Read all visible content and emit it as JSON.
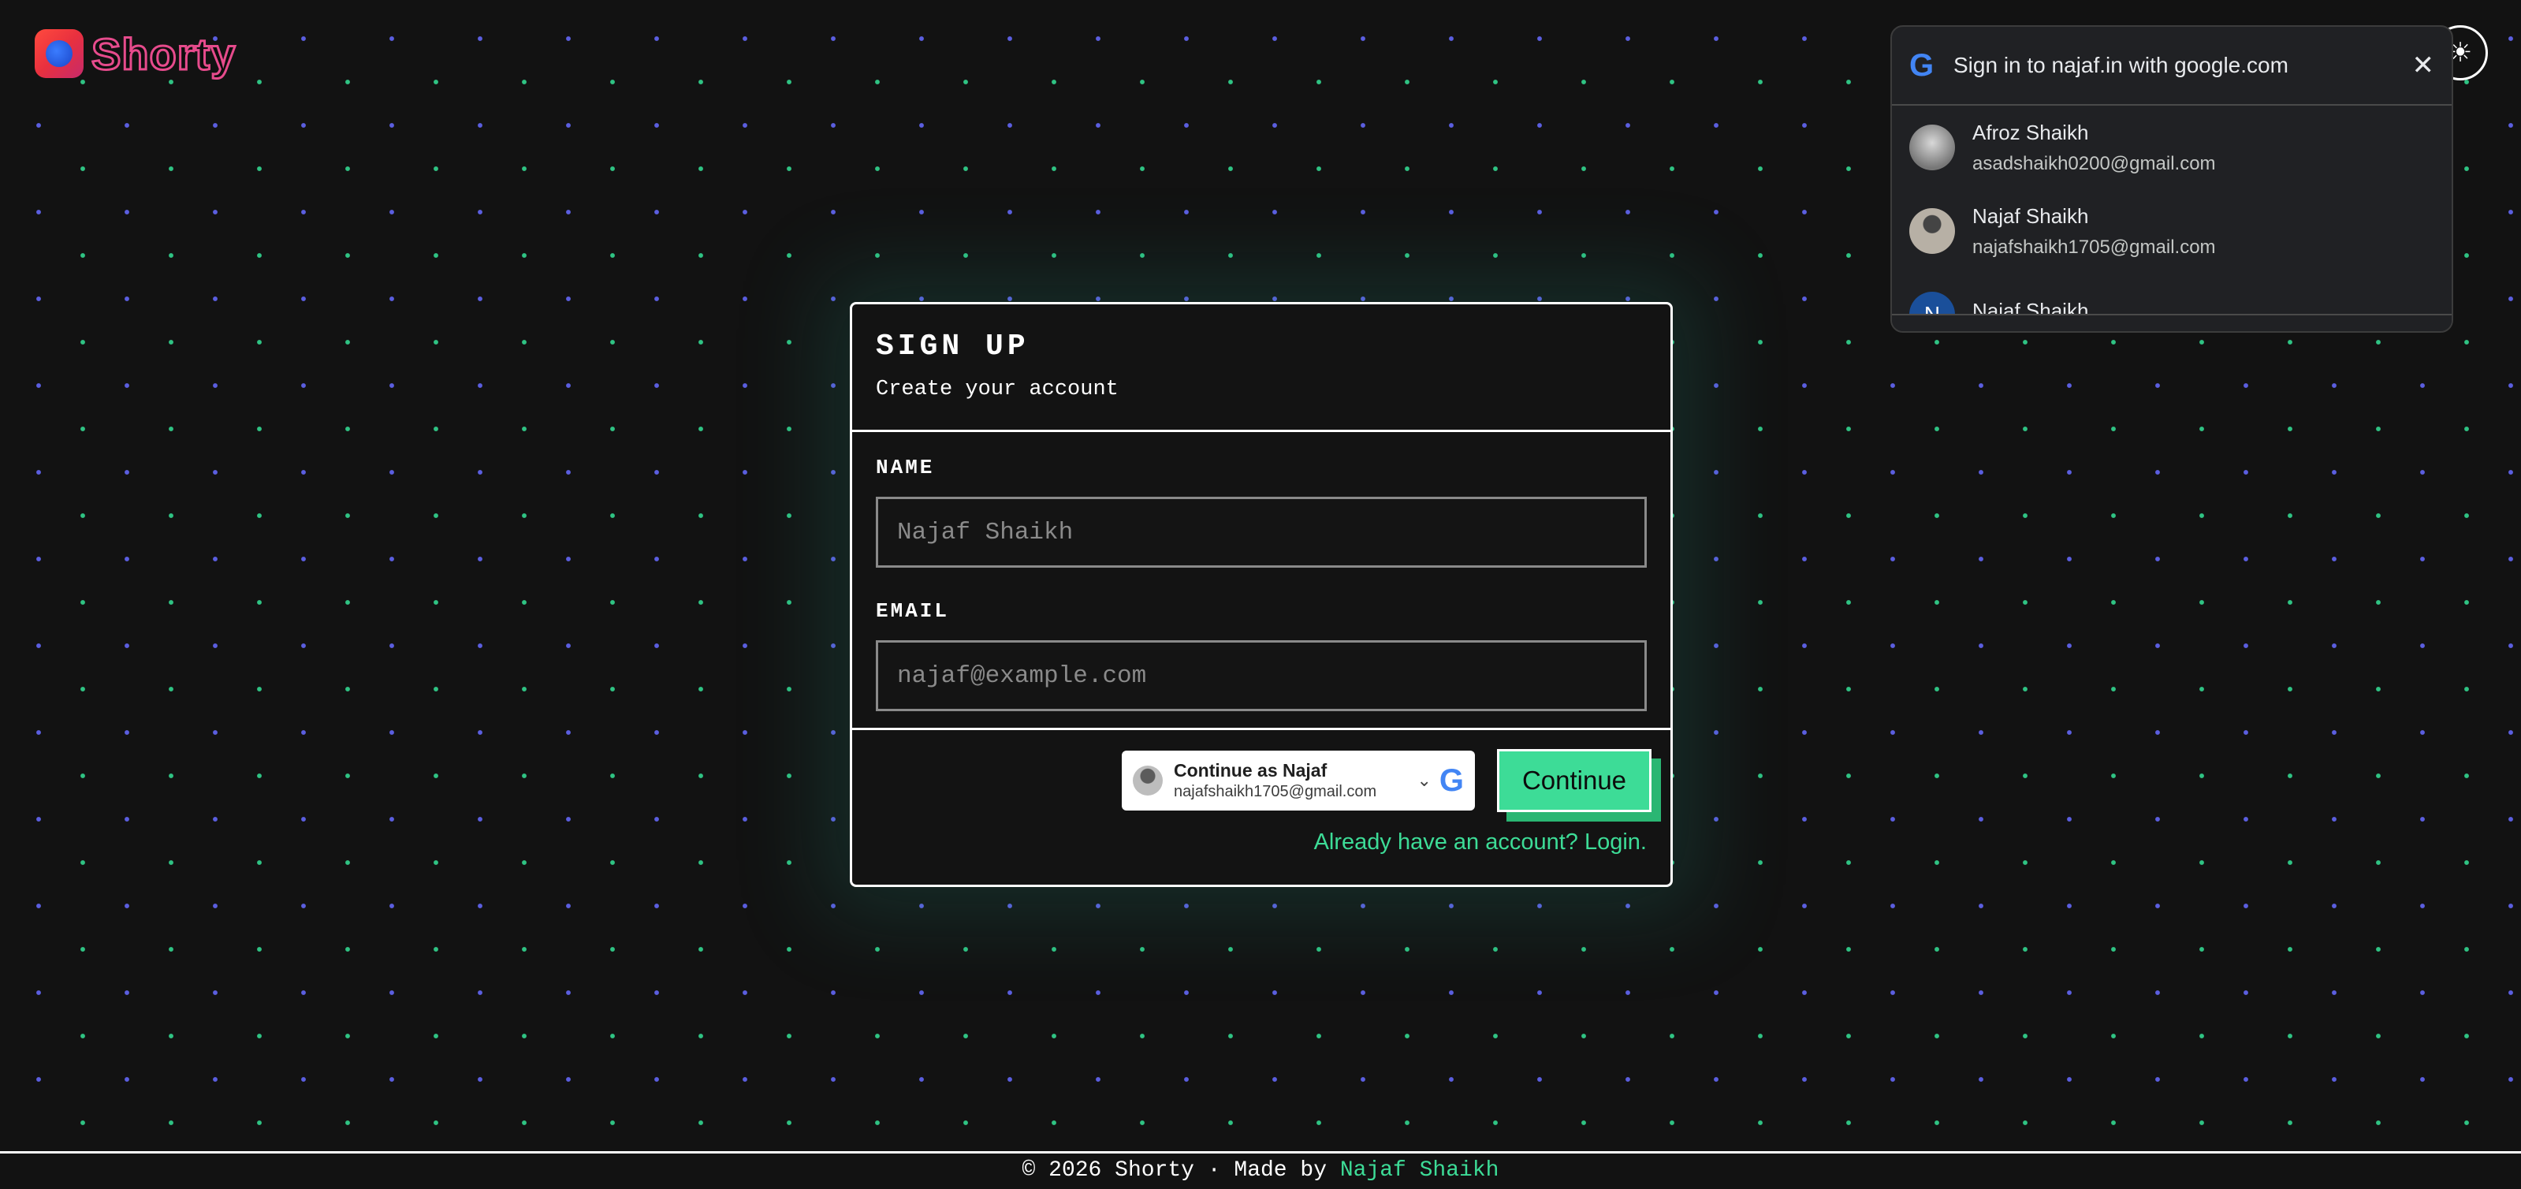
{
  "brand": {
    "name": "Shorty"
  },
  "signup": {
    "title": "SIGN UP",
    "subtitle": "Create your account",
    "name_label": "NAME",
    "name_placeholder": "Najaf Shaikh",
    "email_label": "EMAIL",
    "email_placeholder": "najaf@example.com",
    "google_button": {
      "title": "Continue as Najaf",
      "email": "najafshaikh1705@gmail.com"
    },
    "continue_label": "Continue",
    "login_link": "Already have an account? Login."
  },
  "google_popup": {
    "title": "Sign in to najaf.in with google.com",
    "accounts": [
      {
        "name": "Afroz Shaikh",
        "email": "asadshaikh0200@gmail.com",
        "avatar": "photo"
      },
      {
        "name": "Najaf Shaikh",
        "email": "najafshaikh1705@gmail.com",
        "avatar": "photo"
      },
      {
        "name": "Najaf Shaikh",
        "email": "",
        "avatar": "N"
      }
    ]
  },
  "footer": {
    "text": "© 2026 Shorty · Made by ",
    "author": "Najaf Shaikh"
  },
  "icons": {
    "theme_toggle": "sun-icon",
    "close": "close-icon",
    "google": "google-g-icon"
  },
  "colors": {
    "accent": "#3ddc97",
    "background": "#121212",
    "dot_blue": "#5b5ee0",
    "dot_green": "#2fc383"
  }
}
